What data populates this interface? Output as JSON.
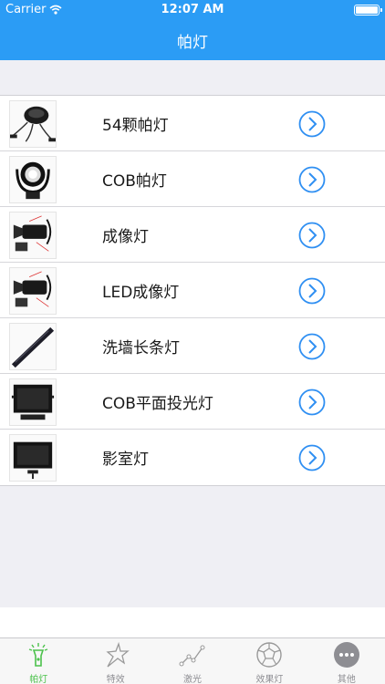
{
  "status": {
    "carrier": "Carrier",
    "time": "12:07 AM"
  },
  "nav": {
    "title": "帕灯"
  },
  "items": [
    {
      "label": "54颗帕灯",
      "icon": "par-light-icon"
    },
    {
      "label": "COB帕灯",
      "icon": "cob-par-icon"
    },
    {
      "label": "成像灯",
      "icon": "profile-spot-icon"
    },
    {
      "label": "LED成像灯",
      "icon": "led-profile-icon"
    },
    {
      "label": "洗墙长条灯",
      "icon": "wall-washer-icon"
    },
    {
      "label": "COB平面投光灯",
      "icon": "cob-panel-icon"
    },
    {
      "label": "影室灯",
      "icon": "studio-light-icon"
    }
  ],
  "tabs": [
    {
      "label": "帕灯",
      "icon": "flashlight-icon",
      "active": true
    },
    {
      "label": "特效",
      "icon": "star-icon"
    },
    {
      "label": "激光",
      "icon": "laser-icon"
    },
    {
      "label": "效果灯",
      "icon": "effect-ball-icon"
    },
    {
      "label": "其他",
      "icon": "more-icon"
    }
  ],
  "colors": {
    "accent": "#2b9cf5",
    "active_tab": "#4cc24c",
    "chevron": "#2f8ff2"
  }
}
